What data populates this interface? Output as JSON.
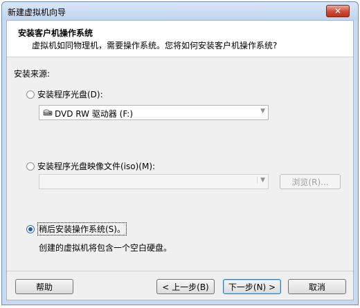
{
  "window": {
    "title": "新建虚拟机向导",
    "close_glyph": "✕"
  },
  "header": {
    "title": "安装客户机操作系统",
    "description": "虚拟机如同物理机，需要操作系统。您将如何安装客户机操作系统?"
  },
  "source": {
    "label": "安装来源:"
  },
  "options": {
    "disc": {
      "label": "安装程序光盘(D):",
      "selected": false,
      "drive_value": "DVD RW 驱动器 (F:)",
      "drive_icon": "dvd-drive-icon"
    },
    "iso": {
      "label": "安装程序光盘映像文件(iso)(M):",
      "selected": false,
      "path_value": "",
      "browse_label": "浏览(R)..."
    },
    "later": {
      "label": "稍后安装操作系统(S)。",
      "selected": true,
      "description": "创建的虚拟机将包含一个空白硬盘。"
    }
  },
  "buttons": {
    "help": "帮助",
    "back": "< 上一步(B)",
    "next": "下一步(N) >",
    "cancel": "取消"
  },
  "colors": {
    "accent": "#1f5db0",
    "titlebar": "#c9daf0",
    "close": "#cf4a35"
  }
}
